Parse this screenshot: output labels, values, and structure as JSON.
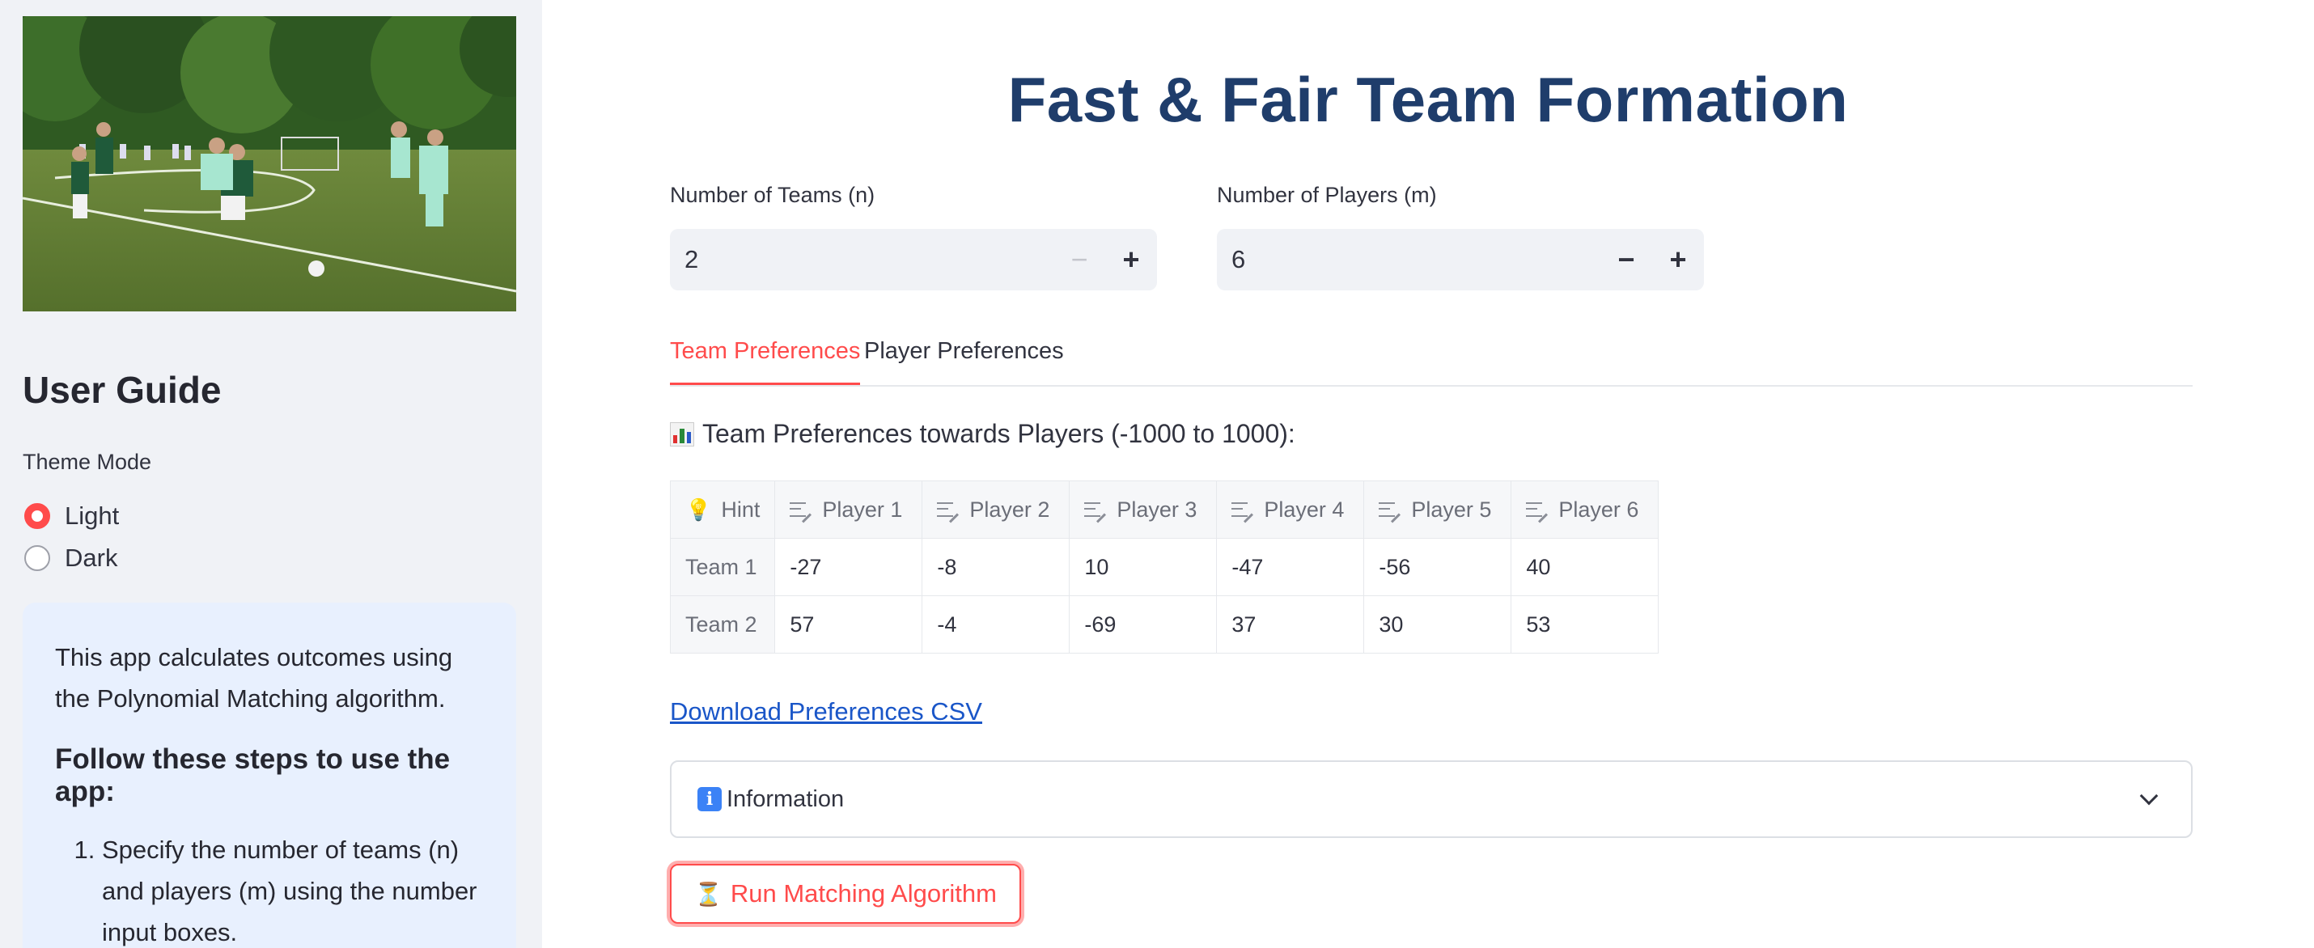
{
  "sidebar": {
    "heading": "User Guide",
    "theme_label": "Theme Mode",
    "theme_options": [
      {
        "label": "Light",
        "checked": true
      },
      {
        "label": "Dark",
        "checked": false
      }
    ],
    "info": {
      "intro": "This app calculates outcomes using the Polynomial Matching algorithm.",
      "steps_heading": "Follow these steps to use the app:",
      "steps": [
        "Specify the number of teams (n) and players (m) using the number input boxes."
      ]
    }
  },
  "main": {
    "title": "Fast & Fair Team Formation",
    "teams_input": {
      "label": "Number of Teams (n)",
      "value": "2"
    },
    "players_input": {
      "label": "Number of Players (m)",
      "value": "6"
    },
    "tabs": [
      {
        "label": "Team Preferences",
        "active": true
      },
      {
        "label": "Player Preferences",
        "active": false
      }
    ],
    "section_heading": "Team Preferences towards Players (-1000 to 1000):",
    "table": {
      "hint_header": "Hint",
      "columns": [
        "Player 1",
        "Player 2",
        "Player 3",
        "Player 4",
        "Player 5",
        "Player 6"
      ],
      "rows": [
        {
          "label": "Team 1",
          "values": [
            "-27",
            "-8",
            "10",
            "-47",
            "-56",
            "40"
          ]
        },
        {
          "label": "Team 2",
          "values": [
            "57",
            "-4",
            "-69",
            "37",
            "30",
            "53"
          ]
        }
      ]
    },
    "download_link": "Download Preferences CSV",
    "expander_label": "Information",
    "run_button": "Run Matching Algorithm"
  },
  "colors": {
    "accent": "#ff4b4b",
    "title": "#1f3d6b",
    "link": "#1a56c8",
    "sidebar_bg": "#f0f2f6",
    "info_bg": "#e8f0fe"
  }
}
